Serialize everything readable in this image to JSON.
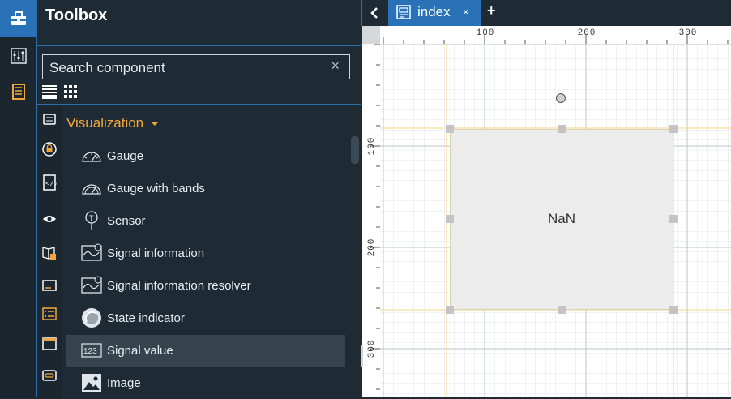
{
  "rail": {
    "items": [
      {
        "icon": "toolbox-icon",
        "active": true
      },
      {
        "icon": "dashboard-icon",
        "active": false
      },
      {
        "icon": "document-list-icon",
        "active": false
      }
    ]
  },
  "toolbox": {
    "title": "Toolbox",
    "search_placeholder": "Search component",
    "clear_label": "×",
    "view_modes": [
      "list-view-icon",
      "grid-view-icon"
    ]
  },
  "categories": [
    "list-category-icon",
    "lock-category-icon",
    "script-category-icon",
    "eye-category-icon",
    "book-category-icon",
    "display-category-icon",
    "list-items-category-icon",
    "window-category-icon",
    "link-category-icon"
  ],
  "category": {
    "title": "Visualization",
    "components": [
      {
        "label": "Gauge",
        "icon": "gauge-icon"
      },
      {
        "label": "Gauge with bands",
        "icon": "gauge-bands-icon"
      },
      {
        "label": "Sensor",
        "icon": "sensor-icon"
      },
      {
        "label": "Signal information",
        "icon": "signal-info-icon"
      },
      {
        "label": "Signal information resolver",
        "icon": "signal-resolver-icon"
      },
      {
        "label": "State indicator",
        "icon": "state-indicator-icon"
      },
      {
        "label": "Signal value",
        "icon": "signal-value-icon",
        "highlighted": true
      },
      {
        "label": "Image",
        "icon": "image-icon"
      }
    ]
  },
  "tabs": {
    "back_icon": "chevron-left-icon",
    "items": [
      {
        "label": "index",
        "close": "×",
        "active": true
      }
    ],
    "add_label": "+"
  },
  "ruler": {
    "top_labels": [
      "100",
      "200",
      "300"
    ],
    "left_labels": [
      "100",
      "200",
      "300"
    ]
  },
  "widget": {
    "value": "NaN"
  },
  "colors": {
    "accent": "#2a72b8",
    "category": "#f0a63c",
    "panel": "#1f2b34",
    "guide": "#f5d68a"
  }
}
